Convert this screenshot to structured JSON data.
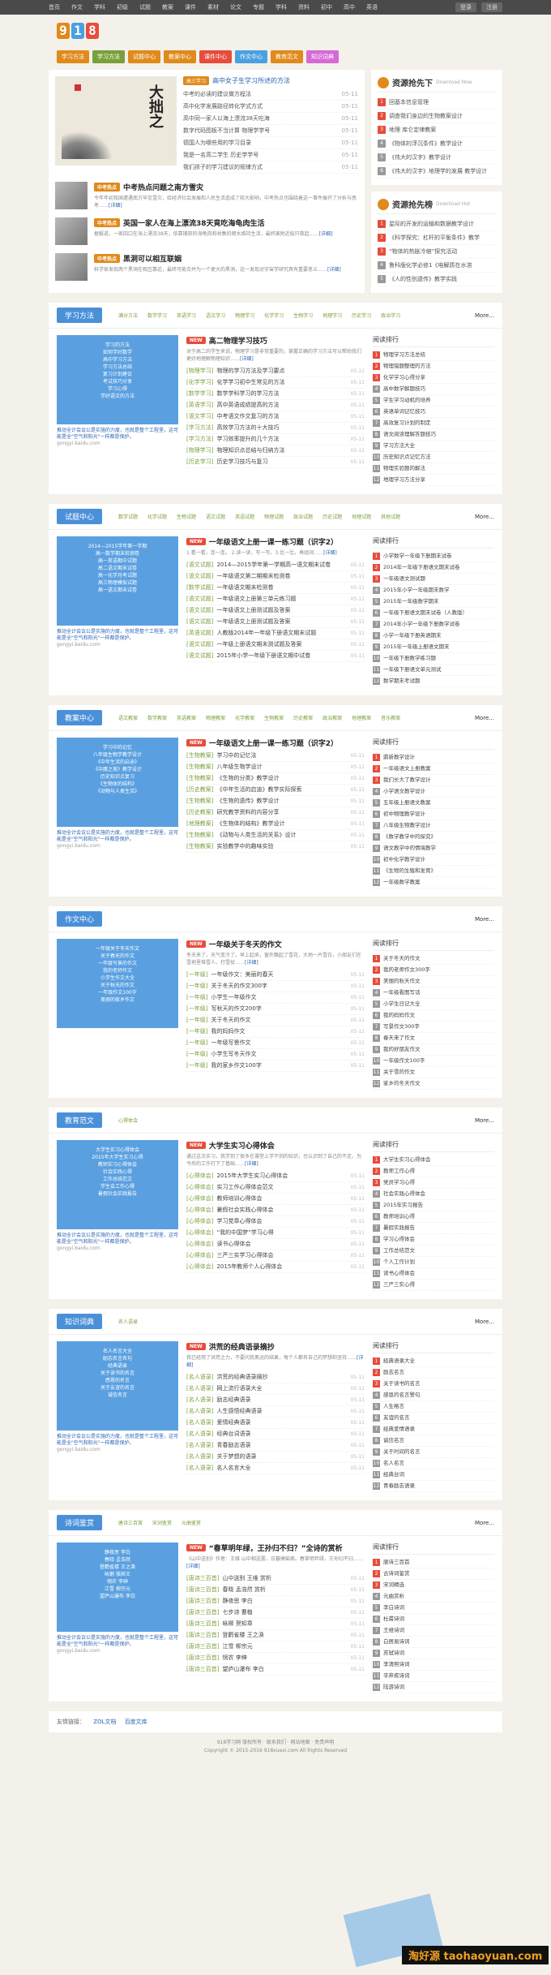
{
  "topbar": {
    "nav": [
      "首页",
      "作文",
      "学科",
      "初级",
      "试题",
      "教案",
      "课件",
      "素材",
      "论文",
      "专题",
      "学科",
      "资料",
      "初中",
      "高中",
      "英语"
    ],
    "login": [
      "登录",
      "注册"
    ]
  },
  "logo": [
    "9",
    "1",
    "8"
  ],
  "logo_colors": [
    "#e08a1c",
    "#4aa0e0",
    "#e74c3c"
  ],
  "tabs": [
    {
      "label": "学习方法",
      "color": "#e08a1c"
    },
    {
      "label": "学习方法",
      "color": "#7aa03c"
    },
    {
      "label": "试题中心",
      "color": "#e08a1c"
    },
    {
      "label": "教案中心",
      "color": "#e08a1c"
    },
    {
      "label": "课件中心",
      "color": "#e74c3c"
    },
    {
      "label": "作文中心",
      "color": "#4aa0e0"
    },
    {
      "label": "教育范文",
      "color": "#e08a1c"
    },
    {
      "label": "知识词典",
      "color": "#d56ad5"
    }
  ],
  "hero": {
    "calligraphy": "大拙之",
    "badge": "高三学习",
    "title": "高中女子生学习所述的方法",
    "items": [
      {
        "t": "中考的必读的建议做方程法",
        "d": "05-11"
      },
      {
        "t": "高中化学发展路径转化学式方式",
        "d": "05-11"
      },
      {
        "t": "高中同一家人以海上漂流38天吃海",
        "d": "05-11"
      },
      {
        "t": "数字代码图板不当计算 物理学学号",
        "d": "05-11"
      },
      {
        "t": "德国人为哪些用的学习目录",
        "d": "05-11"
      },
      {
        "t": "我是一名高二学生 历史学学号",
        "d": "05-11"
      },
      {
        "t": "我们孩子的学习建议的规律方式",
        "d": "05-11"
      }
    ]
  },
  "news": [
    {
      "title": "中考热点问题之南方雪灾",
      "badge": "中考热点",
      "text": "今年年初我国遭遇南方罕见雪灾，给经济社会发展和人民生活造成了较大影响，中考热点也围绕着这一事件展开了分析与思考……",
      "link": "[详细]"
    },
    {
      "title": "英国一家人在海上漂流38天竟吃海龟肉生活",
      "badge": "中考热点",
      "text": "据报道，一家四口在海上漂流38天，依靠捕获的海龟肉和收集的雨水维持生活，最终被附近船只救起……",
      "link": "[详细]"
    },
    {
      "title": "黑洞可以相互联姻",
      "badge": "中考热点",
      "text": "科学家发现两个黑洞在相互靠近，最终可能合并为一个更大的黑洞，这一发现对宇宙学研究具有重要意义……",
      "link": "[详细]"
    }
  ],
  "download": {
    "title": "资源抢先下",
    "sub": "Download Now",
    "items": [
      "回基本信息管理",
      "调查我们身边的生物教案设计",
      "地理 库仑定律教案",
      "《物体的浮沉条件》教学设计",
      "《伟大的汉字》教学设计",
      "《伟大的汉字》地理学的发展 教学设计"
    ]
  },
  "download2": {
    "title": "资源抢先榜",
    "sub": "Download Hot",
    "items": [
      "星际的开发的运输和数据教学设计",
      "《科学探究：杠杆的平衡条件》教学",
      "“物体的热胀冷缩”探究活动",
      "鲁科版化学必修1《电解质在水溶",
      "《人的性别遗传》教学实践"
    ]
  },
  "sections": [
    {
      "title": "学习方法",
      "links": [
        "满分方法",
        "数学学习",
        "英语学习",
        "语文学习",
        "物理学习",
        "化学学习",
        "生物学习",
        "地理学习",
        "历史学习",
        "政治学习"
      ],
      "more": "More...",
      "image_lines": [
        "学习的方法",
        "如何学好数学",
        "高中学习方法",
        "学习方法总结",
        "复习计划建议",
        "考试技巧分享",
        "学习心得",
        "学好语文的方法"
      ],
      "ad": "推动全计会议公是实施的力度，也就是整个工程里，这可能是全\"空气和阳光\"一样都是保护。",
      "ad_src": "gongyi.baidu.com",
      "feat_title": "高二物理学习技巧",
      "feat_text": "对于高二的学生来说，物理学习是非常重要的，掌握正确的学习方法可以帮助我们更好地理解物理知识……",
      "feat_link": "[详细]",
      "articles": [
        {
          "c": "[物理学习]",
          "n": "物理的学习方法及学习要点",
          "d": "05-11"
        },
        {
          "c": "[化学学习]",
          "n": "化学学习初中生常见的方法",
          "d": "05-11"
        },
        {
          "c": "[数学学习]",
          "n": "数学学科学习的学习方法",
          "d": "05-11"
        },
        {
          "c": "[英语学习]",
          "n": "高中英语成绩提高的方法",
          "d": "05-11"
        },
        {
          "c": "[语文学习]",
          "n": "中考语文作文复习的方法",
          "d": "05-11"
        },
        {
          "c": "[学习方法]",
          "n": "高效学习方法的十大技巧",
          "d": "05-11"
        },
        {
          "c": "[学习方法]",
          "n": "学习效率提升的几个方法",
          "d": "05-11"
        },
        {
          "c": "[物理学习]",
          "n": "物理知识点总结与归纳方法",
          "d": "05-11"
        },
        {
          "c": "[历史学习]",
          "n": "历史学习技巧与复习",
          "d": "05-11"
        }
      ],
      "rank_title": "阅读排行",
      "rank": [
        "物理学习方法总结",
        "物理错题整理的方法",
        "化学学习心得分享",
        "高中数学解题技巧",
        "学生学习动机的培养",
        "英语单词记忆技巧",
        "高效复习计划的制定",
        "语文阅读理解答题技巧",
        "学习方法大全",
        "历史知识点记忆方法",
        "物理实验题的解法",
        "地理学习方法分享"
      ]
    },
    {
      "title": "试题中心",
      "links": [
        "数学试题",
        "化学试题",
        "生物试题",
        "语文试题",
        "英语试题",
        "物理试题",
        "政治试题",
        "历史试题",
        "地理试题",
        "其他试题"
      ],
      "more": "More...",
      "image_lines": [
        "2014—2015学年第一学期",
        "高一数学期末检测卷",
        "高一英语期中试题",
        "高二语文期末试卷",
        "高一化学月考试题",
        "高三物理模拟试题",
        "高一语文期末试卷"
      ],
      "ad": "推动全计会议公是实施的力度，也就是整个工程里，这可能是全\"空气和阳光\"一样都是保护。",
      "ad_src": "gongyi.baidu.com",
      "feat_title": "一年级语文上册一课一练习题（识字2）",
      "feat_text": "1.看一看，连一连。 2.读一读，写一写。3.比一比，再组词……",
      "feat_link": "[详细]",
      "articles": [
        {
          "c": "[语文试题]",
          "n": "2014—2015学年第一学期高一语文期末试卷",
          "d": "05-11"
        },
        {
          "c": "[语文试题]",
          "n": "一年级语文第二期期末检测卷",
          "d": "05-11"
        },
        {
          "c": "[数学试题]",
          "n": "一年级语文期末检测卷",
          "d": "05-11"
        },
        {
          "c": "[语文试题]",
          "n": "一年级语文上册第三单元练习题",
          "d": "05-11"
        },
        {
          "c": "[语文试题]",
          "n": "一年级语文上册测试题及答案",
          "d": "05-11"
        },
        {
          "c": "[语文试题]",
          "n": "一年级语文上册测试题及答案",
          "d": "05-11"
        },
        {
          "c": "[英语试题]",
          "n": "人教版2014年一年级下册语文期末试题",
          "d": "05-11"
        },
        {
          "c": "[语文试题]",
          "n": "一年级上册语文期末测试题及答案",
          "d": "05-11"
        },
        {
          "c": "[语文试题]",
          "n": "2015年小学一年级下册语文期中试卷",
          "d": "05-11"
        }
      ],
      "rank_title": "阅读排行",
      "rank": [
        "小学数学一年级下册期末试卷",
        "2014年一年级下册语文期末试卷",
        "一年级语文测试题",
        "2015年小学一年级期末数学",
        "2015年一年级数学期末",
        "一年级下册语文期末试卷（人教版）",
        "2014年小学一年级下册数学试卷",
        "小学一年级下册英语期末",
        "2015年一年级上册语文期末",
        "一年级下册数学练习题",
        "一年级下册语文单元测试",
        "数学期末考试题"
      ]
    },
    {
      "title": "教案中心",
      "links": [
        "语文教案",
        "数学教案",
        "英语教案",
        "物理教案",
        "化学教案",
        "生物教案",
        "历史教案",
        "政治教案",
        "地理教案",
        "音乐教案"
      ],
      "more": "More...",
      "image_lines": [
        "学习中的记忆",
        "八年级生物学教学设计",
        "《中年生活的启迪》",
        "《中庸之美》教学设计",
        "历史知识点复习",
        "《生物体的结构》",
        "《动物与人类生活》"
      ],
      "ad": "推动全计会议公是实施的力度，也就是整个工程里，这可能是全\"空气和阳光\"一样都是保护。",
      "ad_src": "gongyi.baidu.com",
      "feat_title": "一年级语文上册一课一练习题（识字2）",
      "feat_text": "",
      "feat_link": "",
      "articles": [
        {
          "c": "[生物教案]",
          "n": "学习中的记忆法",
          "d": "05-11"
        },
        {
          "c": "[生物教案]",
          "n": "八年级生物学设计",
          "d": "05-11"
        },
        {
          "c": "[生物教案]",
          "n": "《生物的分类》教学设计",
          "d": "05-11"
        },
        {
          "c": "[历史教案]",
          "n": "《中年生活的启迪》教学实际探索",
          "d": "05-11"
        },
        {
          "c": "[生物教案]",
          "n": "《生物的遗传》教学设计",
          "d": "05-11"
        },
        {
          "c": "[历史教案]",
          "n": "研究教学资料的内容分享",
          "d": "05-11"
        },
        {
          "c": "[地理教案]",
          "n": "《生物体的结构》教学设计",
          "d": "05-11"
        },
        {
          "c": "[生物教案]",
          "n": "《动物与人类生活的关系》设计",
          "d": "05-11"
        },
        {
          "c": "[生物教案]",
          "n": "实验教学中的趣味实验",
          "d": "05-11"
        }
      ],
      "rank_title": "阅读排行",
      "rank": [
        "鼎新教学设计",
        "一年级语文上册教案",
        "我们长大了教学设计",
        "小学语文教学设计",
        "五年级上册语文教案",
        "初中物理教学设计",
        "八年级生物教学设计",
        "《数学教学中的探究》",
        "语文教学中的情境教学",
        "初中化学教学设计",
        "《生物的生殖和发育》",
        "一年级数学教案"
      ]
    },
    {
      "title": "作文中心",
      "links": [],
      "more": "More...",
      "image_lines": [
        "一年级关于冬天作文",
        "关于春天的作文",
        "一年级写景的作文",
        "我的老师作文",
        "小学生作文大全",
        "关于秋天的作文",
        "一年级作文100字",
        "美丽的家乡作文"
      ],
      "ad": "",
      "ad_src": "",
      "feat_title": "一年级关于冬天的作文",
      "feat_text": "冬天来了，天气变冷了。早上起来，窗外飘起了雪花，大地一片雪白，小朋友们在雪地里堆雪人、打雪仗……",
      "feat_link": "[详细]",
      "articles": [
        {
          "c": "[一年级]",
          "n": "一年级作文：美丽的春天",
          "d": "05-11"
        },
        {
          "c": "[一年级]",
          "n": "关于冬天的作文300字",
          "d": "05-11"
        },
        {
          "c": "[一年级]",
          "n": "小学生一年级作文",
          "d": "05-11"
        },
        {
          "c": "[一年级]",
          "n": "写秋天的作文200字",
          "d": "05-11"
        },
        {
          "c": "[一年级]",
          "n": "关于冬天的作文",
          "d": "05-11"
        },
        {
          "c": "[一年级]",
          "n": "我的妈妈作文",
          "d": "05-11"
        },
        {
          "c": "[一年级]",
          "n": "一年级写景作文",
          "d": "05-11"
        },
        {
          "c": "[一年级]",
          "n": "小学生写冬天作文",
          "d": "05-11"
        },
        {
          "c": "[一年级]",
          "n": "我的家乡作文100字",
          "d": "05-11"
        }
      ],
      "rank_title": "阅读排行",
      "rank": [
        "关于冬天的作文",
        "我的老师作文300字",
        "美丽的秋天作文",
        "一年级看图写话",
        "小学生日记大全",
        "我的妈妈作文",
        "写景作文300字",
        "春天来了作文",
        "我的好朋友作文",
        "一年级作文100字",
        "关于雪的作文",
        "家乡的冬天作文"
      ]
    },
    {
      "title": "教育范文",
      "links": [
        "心得体会"
      ],
      "more": "More...",
      "image_lines": [
        "大学生实习心得体会",
        "2015年大学生实习心得",
        "教师实习心得体会",
        "社会实践心得",
        "工作总结范文",
        "学生会工作心得",
        "暑假社会实践报告"
      ],
      "ad": "推动全计会议公是实施的力度，也就是整个工程里，这可能是全\"空气和阳光\"一样都是保护。",
      "ad_src": "gongyi.baidu.com",
      "feat_title": "大学生实习心得体会",
      "feat_text": "通过这次实习，我学到了很多在课堂上学不到的知识，也认识到了自己的不足，为今后的工作打下了基础……",
      "feat_link": "[详细]",
      "articles": [
        {
          "c": "[心得体会]",
          "n": "2015年大学生实习心得体会",
          "d": "05-11"
        },
        {
          "c": "[心得体会]",
          "n": "实习工作心得体会范文",
          "d": "05-11"
        },
        {
          "c": "[心得体会]",
          "n": "教师培训心得体会",
          "d": "05-11"
        },
        {
          "c": "[心得体会]",
          "n": "暑假社会实践心得体会",
          "d": "05-11"
        },
        {
          "c": "[心得体会]",
          "n": "学习党章心得体会",
          "d": "05-11"
        },
        {
          "c": "[心得体会]",
          "n": "“我的中国梦”学习心得",
          "d": "05-11"
        },
        {
          "c": "[心得体会]",
          "n": "读书心得体会",
          "d": "05-11"
        },
        {
          "c": "[心得体会]",
          "n": "三严三实学习心得体会",
          "d": "05-11"
        },
        {
          "c": "[心得体会]",
          "n": "2015年教师个人心得体会",
          "d": "05-11"
        }
      ],
      "rank_title": "阅读排行",
      "rank": [
        "大学生实习心得体会",
        "教师工作心得",
        "党员学习心得",
        "社会实践心得体会",
        "2015年实习报告",
        "教师培训心得",
        "暑假实践报告",
        "学习心得体会",
        "工作总结范文",
        "个人工作计划",
        "读书心得体会",
        "三严三实心得"
      ]
    },
    {
      "title": "知识词典",
      "links": [
        "名人语录"
      ],
      "more": "More...",
      "image_lines": [
        "名人名言大全",
        "励志名言名句",
        "经典语录",
        "关于读书的名言",
        "感恩的名言",
        "关于友谊的名言",
        "诚信名言"
      ],
      "ad": "推动全计会议公是实施的力度，也就是整个工程里，这可能是全\"空气和阳光\"一样都是保护。",
      "ad_src": "gongyi.baidu.com",
      "feat_title": "洪荒的经典语录摘抄",
      "feat_text": "我已经用了洪荒之力，不要问我奥运的结果，每个人都有自己的梦想和坚持……",
      "feat_link": "[详细]",
      "articles": [
        {
          "c": "[名人语录]",
          "n": "洪荒的经典语录摘抄",
          "d": "05-11"
        },
        {
          "c": "[名人语录]",
          "n": "网上流行语录大全",
          "d": "05-11"
        },
        {
          "c": "[名人语录]",
          "n": "励志经典语录",
          "d": "05-11"
        },
        {
          "c": "[名人语录]",
          "n": "人生感悟经典语录",
          "d": "05-11"
        },
        {
          "c": "[名人语录]",
          "n": "爱情经典语录",
          "d": "05-11"
        },
        {
          "c": "[名人语录]",
          "n": "经典台词语录",
          "d": "05-11"
        },
        {
          "c": "[名人语录]",
          "n": "青春励志语录",
          "d": "05-11"
        },
        {
          "c": "[名人语录]",
          "n": "关于梦想的语录",
          "d": "05-11"
        },
        {
          "c": "[名人语录]",
          "n": "名人名言大全",
          "d": "05-11"
        }
      ],
      "rank_title": "阅读排行",
      "rank": [
        "经典语录大全",
        "励志名言",
        "关于读书的名言",
        "感恩的名言警句",
        "人生格言",
        "友谊的名言",
        "经典爱情语录",
        "诚信名言",
        "关于时间的名言",
        "名人名言",
        "经典台词",
        "青春励志语录"
      ]
    },
    {
      "title": "诗词鉴赏",
      "links": [
        "唐诗三百首",
        "宋词鉴赏",
        "元曲鉴赏"
      ],
      "more": "More...",
      "image_lines": [
        "静夜思 李白",
        "春晓 孟浩然",
        "登鹳雀楼 王之涣",
        "咏鹅 骆宾王",
        "悯农 李绅",
        "江雪 柳宗元",
        "望庐山瀑布 李白"
      ],
      "ad": "推动全计会议公是实施的力度，也就是整个工程里，这可能是全\"空气和阳光\"一样都是保护。",
      "ad_src": "gongyi.baidu.com",
      "feat_title": "“春草明年绿，王孙归不归？”全诗的赏析",
      "feat_text": "《山中送别》作者：王维 山中相送罢，日暮掩柴扉。春草明年绿，王孙归不归……",
      "feat_link": "[详细]",
      "articles": [
        {
          "c": "[唐诗三百首]",
          "n": "山中送别 王维 赏析",
          "d": "05-11"
        },
        {
          "c": "[唐诗三百首]",
          "n": "春晓 孟浩然 赏析",
          "d": "05-11"
        },
        {
          "c": "[唐诗三百首]",
          "n": "静夜思 李白",
          "d": "05-11"
        },
        {
          "c": "[唐诗三百首]",
          "n": "七步诗 曹植",
          "d": "05-11"
        },
        {
          "c": "[唐诗三百首]",
          "n": "咏柳 贺知章",
          "d": "05-11"
        },
        {
          "c": "[唐诗三百首]",
          "n": "登鹳雀楼 王之涣",
          "d": "05-11"
        },
        {
          "c": "[唐诗三百首]",
          "n": "江雪 柳宗元",
          "d": "05-11"
        },
        {
          "c": "[唐诗三百首]",
          "n": "悯农 李绅",
          "d": "05-11"
        },
        {
          "c": "[唐诗三百首]",
          "n": "望庐山瀑布 李白",
          "d": "05-11"
        }
      ],
      "rank_title": "阅读排行",
      "rank": [
        "唐诗三百首",
        "古诗词鉴赏",
        "宋词精选",
        "元曲赏析",
        "李白诗词",
        "杜甫诗词",
        "王维诗词",
        "白居易诗词",
        "苏轼诗词",
        "李清照诗词",
        "辛弃疾诗词",
        "陆游诗词"
      ]
    }
  ],
  "footer_links": {
    "label": "友情链接：",
    "items": [
      "ZOL文档",
      "百度文库"
    ]
  },
  "footer": [
    "918学习网 版权所有 · 联系我们 · 网站地图 · 免责声明",
    "Copyright © 2015-2016 918xuexi.com All Rights Reserved"
  ],
  "watermark": "淘好源 taohaoyuan.com"
}
